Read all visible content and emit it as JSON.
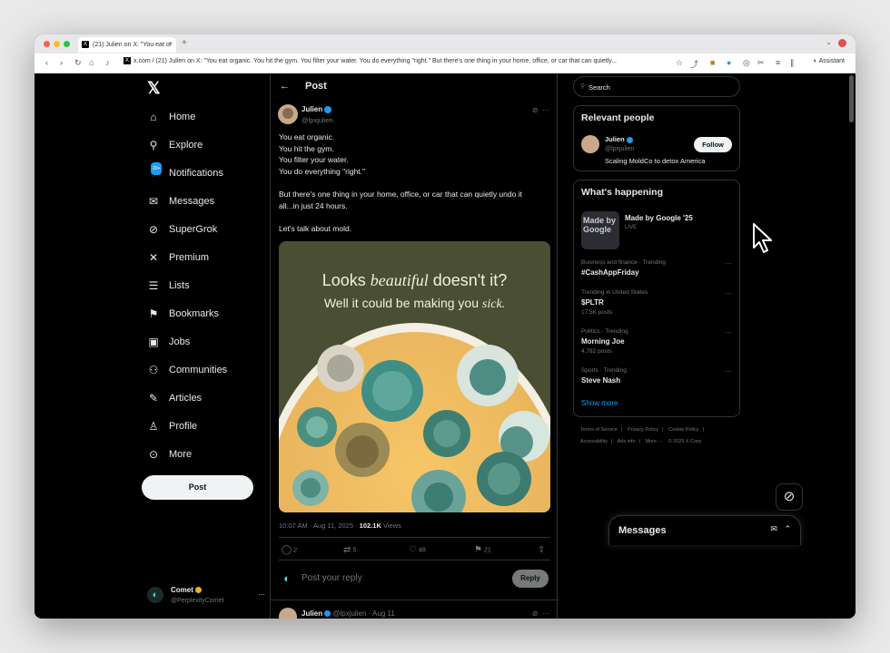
{
  "browser": {
    "tab_title": "(21) Julien on X: \"You eat or",
    "tab_favicon": "X",
    "address_text": "x.com / (21) Julien on X: \"You eat organic. You hit the gym. You filter your water. You do everything \"right.\" But there's one thing in your home, office, or car that can quietly...",
    "assistant_label": "Assistant",
    "traffic_colors": [
      "#ff5f57",
      "#febc2e",
      "#28c840"
    ]
  },
  "nav": {
    "logo": "𝕏",
    "items": [
      {
        "label": "Home",
        "icon": "home-icon",
        "glyph": "⌂"
      },
      {
        "label": "Explore",
        "icon": "search-icon",
        "glyph": "⚲"
      },
      {
        "label": "Notifications",
        "icon": "bell-icon",
        "glyph": "🔔︎",
        "badge": "20+"
      },
      {
        "label": "Messages",
        "icon": "envelope-icon",
        "glyph": "✉"
      },
      {
        "label": "SuperGrok",
        "icon": "grok-icon",
        "glyph": "⊘"
      },
      {
        "label": "Premium",
        "icon": "x-premium-icon",
        "glyph": "𝕏"
      },
      {
        "label": "Lists",
        "icon": "list-icon",
        "glyph": "☰"
      },
      {
        "label": "Bookmarks",
        "icon": "bookmark-icon",
        "glyph": "⚑"
      },
      {
        "label": "Jobs",
        "icon": "briefcase-icon",
        "glyph": "⌧"
      },
      {
        "label": "Communities",
        "icon": "people-icon",
        "glyph": "⚇"
      },
      {
        "label": "Articles",
        "icon": "article-icon",
        "glyph": "✎"
      },
      {
        "label": "Profile",
        "icon": "person-icon",
        "glyph": "♙"
      },
      {
        "label": "More",
        "icon": "more-circle-icon",
        "glyph": "⋯"
      }
    ],
    "post_label": "Post",
    "account": {
      "name": "Comet",
      "handle": "@PerplexityComet"
    }
  },
  "post": {
    "header_title": "Post",
    "author_name": "Julien",
    "author_handle": "@lpxjulien",
    "lines": [
      "You eat organic.",
      "You hit the gym.",
      "You filter your water.",
      "You do everything \"right.\"",
      "",
      "But there's one thing in your home, office, or car that can quietly undo it",
      "all...in just 24 hours.",
      "",
      "Let's talk about mold."
    ],
    "media_headline_pre": "Looks ",
    "media_headline_em": "beautiful",
    "media_headline_post": " doesn't it?",
    "media_sub_pre": "Well it could be making you ",
    "media_sub_em": "sick.",
    "timestamp": "10:07 AM · Aug 11, 2025 · ",
    "views_count": "102.1K",
    "views_label": " Views",
    "actions": {
      "replies": "2",
      "reposts": "5",
      "likes": "48",
      "bookmarks": "21"
    },
    "reply_placeholder": "Post your reply",
    "reply_button": "Reply",
    "next_reply": {
      "name": "Julien",
      "handle": "@lpxjulien · Aug 11"
    }
  },
  "sidebar": {
    "search_placeholder": "Search",
    "relevant_title": "Relevant people",
    "person": {
      "name": "Julien",
      "handle": "@lpxjulien",
      "bio": "Scaling MoldCo to detox America",
      "follow_label": "Follow"
    },
    "happening_title": "What's happening",
    "featured": {
      "title": "Made by Google '25",
      "status": "LIVE",
      "thumb_text": "Made by Google"
    },
    "trends": [
      {
        "meta": "Business and finance · Trending",
        "name": "#CashAppFriday",
        "posts": ""
      },
      {
        "meta": "Trending in United States",
        "name": "$PLTR",
        "posts": "17.5K posts"
      },
      {
        "meta": "Politics · Trending",
        "name": "Morning Joe",
        "posts": "4,782 posts"
      },
      {
        "meta": "Sports · Trending",
        "name": "Steve Nash",
        "posts": ""
      }
    ],
    "show_more": "Show more",
    "footer_links": [
      "Terms of Service",
      "|",
      "Privacy Policy",
      "|",
      "Cookie Policy",
      "|",
      "Accessibility",
      "|",
      "Ads info",
      "|",
      "More ···",
      "© 2025 X Corp."
    ]
  },
  "drawer": {
    "messages_title": "Messages"
  },
  "colors": {
    "accent": "#1d9bf0",
    "background": "#000000",
    "border": "#2f3336",
    "muted": "#71767b"
  }
}
